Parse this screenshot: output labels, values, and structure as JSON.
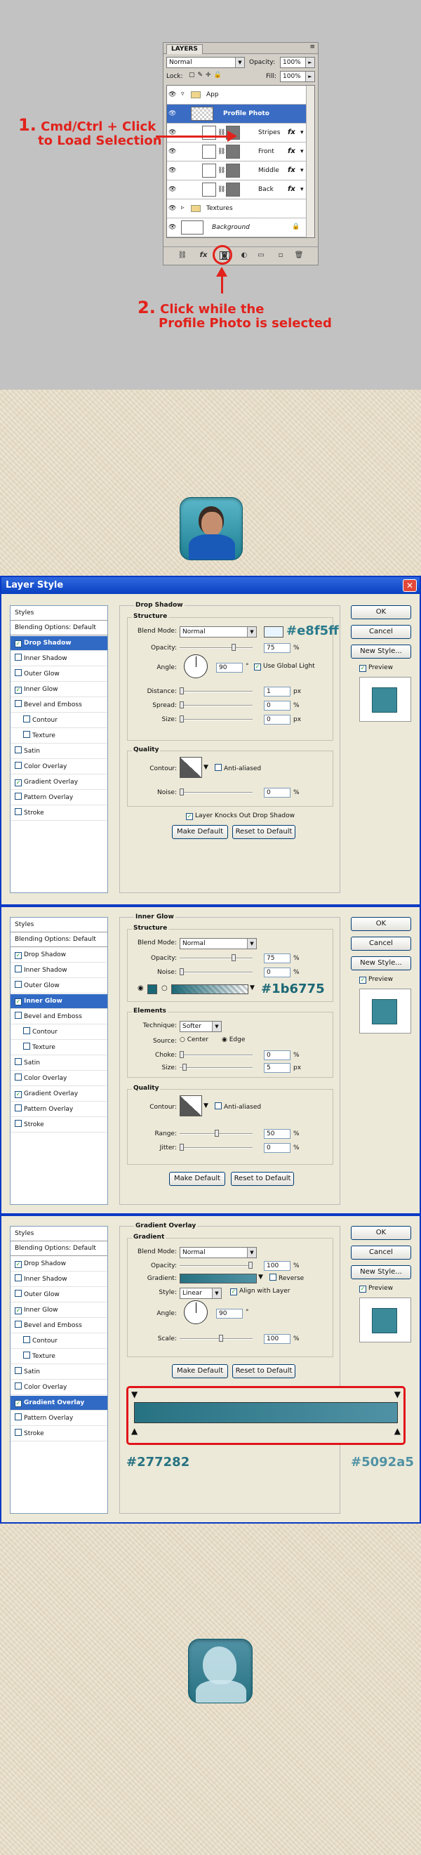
{
  "layers_panel": {
    "tab": "LAYERS",
    "blend_mode": "Normal",
    "opacity_label": "Opacity:",
    "opacity_value": "100%",
    "lock_label": "Lock:",
    "fill_label": "Fill:",
    "fill_value": "100%",
    "layers": [
      {
        "name": "App"
      },
      {
        "name": "Profile Photo"
      },
      {
        "name": "Stripes"
      },
      {
        "name": "Front"
      },
      {
        "name": "Middle"
      },
      {
        "name": "Back"
      },
      {
        "name": "Textures"
      },
      {
        "name": "Background"
      }
    ],
    "fx_label": "fx"
  },
  "annotations": {
    "step1_num": "1.",
    "step1_line1": "Cmd/Ctrl + Click",
    "step1_line2": "to Load Selection",
    "step2_num": "2.",
    "step2_line1": "Click while the",
    "step2_line2": "Profile Photo is selected"
  },
  "dialog": {
    "title": "Layer Style",
    "styles_header": "Styles",
    "blending_options": "Blending Options: Default",
    "style_items": [
      "Drop Shadow",
      "Inner Shadow",
      "Outer Glow",
      "Inner Glow",
      "Bevel and Emboss",
      "Contour",
      "Texture",
      "Satin",
      "Color Overlay",
      "Gradient Overlay",
      "Pattern Overlay",
      "Stroke"
    ],
    "ok": "OK",
    "cancel": "Cancel",
    "new_style": "New Style...",
    "preview": "Preview",
    "make_default": "Make Default",
    "reset_to_default": "Reset to Default"
  },
  "drop_shadow": {
    "title": "Drop Shadow",
    "structure": "Structure",
    "blend_mode_label": "Blend Mode:",
    "blend_mode": "Normal",
    "color_hex": "#e8f5ff",
    "opacity_label": "Opacity:",
    "opacity": "75",
    "angle_label": "Angle:",
    "angle": "90",
    "use_global_light": "Use Global Light",
    "distance_label": "Distance:",
    "distance": "1",
    "spread_label": "Spread:",
    "spread": "0",
    "size_label": "Size:",
    "size": "0",
    "quality": "Quality",
    "contour_label": "Contour:",
    "anti_aliased": "Anti-aliased",
    "noise_label": "Noise:",
    "noise": "0",
    "knockout": "Layer Knocks Out Drop Shadow",
    "unit_pct": "%",
    "unit_px": "px",
    "unit_deg": "°"
  },
  "inner_glow": {
    "title": "Inner Glow",
    "structure": "Structure",
    "blend_mode_label": "Blend Mode:",
    "blend_mode": "Normal",
    "opacity_label": "Opacity:",
    "opacity": "75",
    "noise_label": "Noise:",
    "noise": "0",
    "color_hex": "#1b6775",
    "elements": "Elements",
    "technique_label": "Technique:",
    "technique": "Softer",
    "source_label": "Source:",
    "center": "Center",
    "edge": "Edge",
    "choke_label": "Choke:",
    "choke": "0",
    "size_label": "Size:",
    "size": "5",
    "quality": "Quality",
    "contour_label": "Contour:",
    "anti_aliased": "Anti-aliased",
    "range_label": "Range:",
    "range": "50",
    "jitter_label": "Jitter:",
    "jitter": "0"
  },
  "gradient_overlay": {
    "title": "Gradient Overlay",
    "gradient_group": "Gradient",
    "blend_mode_label": "Blend Mode:",
    "blend_mode": "Normal",
    "opacity_label": "Opacity:",
    "opacity": "100",
    "gradient_label": "Gradient:",
    "reverse": "Reverse",
    "style_label": "Style:",
    "style": "Linear",
    "align_with_layer": "Align with Layer",
    "angle_label": "Angle:",
    "angle": "90",
    "scale_label": "Scale:",
    "scale": "100",
    "left_hex": "#277282",
    "right_hex": "#5092a5",
    "left_color": "#277282",
    "right_color": "#5092a5"
  }
}
